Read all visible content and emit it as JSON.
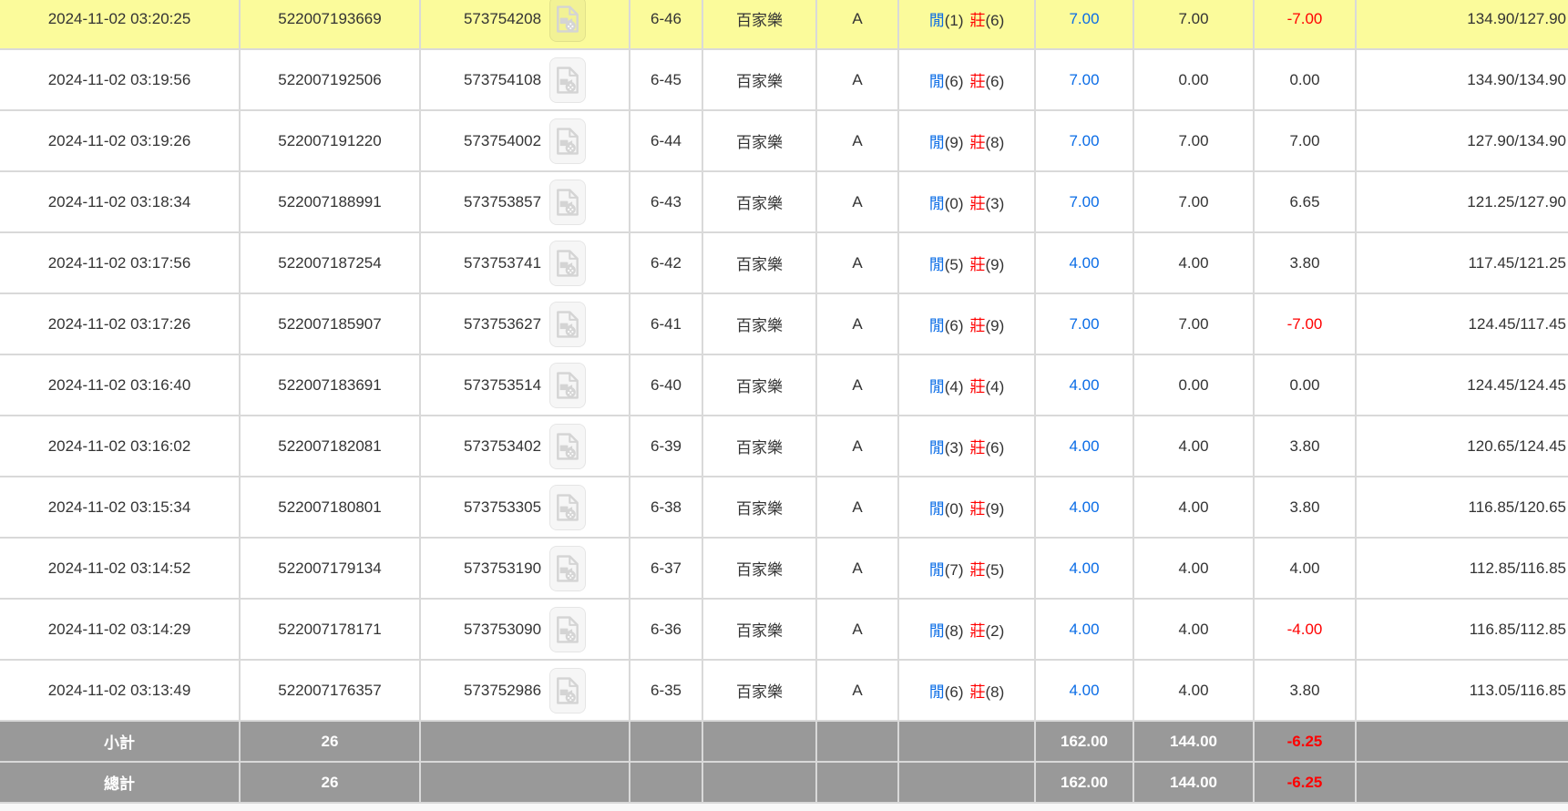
{
  "colors": {
    "highlight_row": "#fbfb9b",
    "summary_row_bg": "#999999",
    "summary_text": "#ffffff",
    "accent_blue": "#0a6ce6",
    "accent_red": "#ff0000",
    "body_text": "#333333",
    "grid_line": "#d9d9d9"
  },
  "table": {
    "player_label": "閒",
    "banker_label": "莊",
    "icon_name": "video-file-icon",
    "rows": [
      {
        "time": "2024-11-02 03:20:25",
        "bet_id": "522007193669",
        "game_id": "573754208",
        "round": "6-46",
        "game": "百家樂",
        "tbl": "A",
        "player": "1",
        "banker": "6",
        "bet": "7.00",
        "valid": "7.00",
        "win": "-7.00",
        "bal": "134.90/127.90",
        "highlight": true
      },
      {
        "time": "2024-11-02 03:19:56",
        "bet_id": "522007192506",
        "game_id": "573754108",
        "round": "6-45",
        "game": "百家樂",
        "tbl": "A",
        "player": "6",
        "banker": "6",
        "bet": "7.00",
        "valid": "0.00",
        "win": "0.00",
        "bal": "134.90/134.90",
        "highlight": false
      },
      {
        "time": "2024-11-02 03:19:26",
        "bet_id": "522007191220",
        "game_id": "573754002",
        "round": "6-44",
        "game": "百家樂",
        "tbl": "A",
        "player": "9",
        "banker": "8",
        "bet": "7.00",
        "valid": "7.00",
        "win": "7.00",
        "bal": "127.90/134.90",
        "highlight": false
      },
      {
        "time": "2024-11-02 03:18:34",
        "bet_id": "522007188991",
        "game_id": "573753857",
        "round": "6-43",
        "game": "百家樂",
        "tbl": "A",
        "player": "0",
        "banker": "3",
        "bet": "7.00",
        "valid": "7.00",
        "win": "6.65",
        "bal": "121.25/127.90",
        "highlight": false
      },
      {
        "time": "2024-11-02 03:17:56",
        "bet_id": "522007187254",
        "game_id": "573753741",
        "round": "6-42",
        "game": "百家樂",
        "tbl": "A",
        "player": "5",
        "banker": "9",
        "bet": "4.00",
        "valid": "4.00",
        "win": "3.80",
        "bal": "117.45/121.25",
        "highlight": false
      },
      {
        "time": "2024-11-02 03:17:26",
        "bet_id": "522007185907",
        "game_id": "573753627",
        "round": "6-41",
        "game": "百家樂",
        "tbl": "A",
        "player": "6",
        "banker": "9",
        "bet": "7.00",
        "valid": "7.00",
        "win": "-7.00",
        "bal": "124.45/117.45",
        "highlight": false
      },
      {
        "time": "2024-11-02 03:16:40",
        "bet_id": "522007183691",
        "game_id": "573753514",
        "round": "6-40",
        "game": "百家樂",
        "tbl": "A",
        "player": "4",
        "banker": "4",
        "bet": "4.00",
        "valid": "0.00",
        "win": "0.00",
        "bal": "124.45/124.45",
        "highlight": false
      },
      {
        "time": "2024-11-02 03:16:02",
        "bet_id": "522007182081",
        "game_id": "573753402",
        "round": "6-39",
        "game": "百家樂",
        "tbl": "A",
        "player": "3",
        "banker": "6",
        "bet": "4.00",
        "valid": "4.00",
        "win": "3.80",
        "bal": "120.65/124.45",
        "highlight": false
      },
      {
        "time": "2024-11-02 03:15:34",
        "bet_id": "522007180801",
        "game_id": "573753305",
        "round": "6-38",
        "game": "百家樂",
        "tbl": "A",
        "player": "0",
        "banker": "9",
        "bet": "4.00",
        "valid": "4.00",
        "win": "3.80",
        "bal": "116.85/120.65",
        "highlight": false
      },
      {
        "time": "2024-11-02 03:14:52",
        "bet_id": "522007179134",
        "game_id": "573753190",
        "round": "6-37",
        "game": "百家樂",
        "tbl": "A",
        "player": "7",
        "banker": "5",
        "bet": "4.00",
        "valid": "4.00",
        "win": "4.00",
        "bal": "112.85/116.85",
        "highlight": false
      },
      {
        "time": "2024-11-02 03:14:29",
        "bet_id": "522007178171",
        "game_id": "573753090",
        "round": "6-36",
        "game": "百家樂",
        "tbl": "A",
        "player": "8",
        "banker": "2",
        "bet": "4.00",
        "valid": "4.00",
        "win": "-4.00",
        "bal": "116.85/112.85",
        "highlight": false
      },
      {
        "time": "2024-11-02 03:13:49",
        "bet_id": "522007176357",
        "game_id": "573752986",
        "round": "6-35",
        "game": "百家樂",
        "tbl": "A",
        "player": "6",
        "banker": "8",
        "bet": "4.00",
        "valid": "4.00",
        "win": "3.80",
        "bal": "113.05/116.85",
        "highlight": false
      }
    ],
    "summary": [
      {
        "label": "小計",
        "count": "26",
        "bet": "162.00",
        "valid": "144.00",
        "win": "-6.25"
      },
      {
        "label": "總計",
        "count": "26",
        "bet": "162.00",
        "valid": "144.00",
        "win": "-6.25"
      }
    ]
  }
}
